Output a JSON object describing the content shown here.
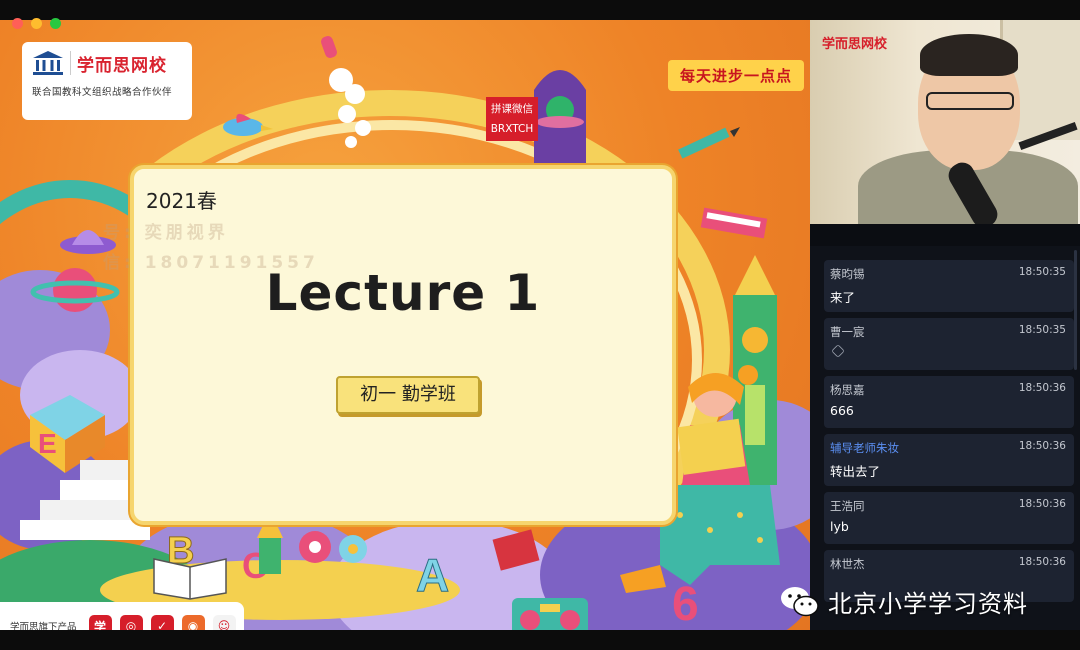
{
  "window": {
    "controls": [
      {
        "name": "close",
        "color": "#ff5f57"
      },
      {
        "name": "minimize",
        "color": "#febc2e"
      },
      {
        "name": "maximize",
        "color": "#28c840"
      }
    ]
  },
  "slide": {
    "logo": {
      "name": "学而思网校",
      "subtitle": "联合国教科文组织战略合作伙伴"
    },
    "motto": "每天进步一点点",
    "wechat_tag": {
      "line1": "拼课微信",
      "line2": "BRXTCH"
    },
    "watermark": {
      "line1": "号: 奕朋视界",
      "line2": "信: 18071191557"
    },
    "card": {
      "season": "2021春",
      "title": "Lecture 1",
      "class_name": "初一  勤学班"
    },
    "product_bar": {
      "label": "学而思旗下产品",
      "apps": [
        {
          "icon": "xue-app-icon",
          "glyph": "学"
        },
        {
          "icon": "search-app-icon",
          "glyph": "◎"
        },
        {
          "icon": "check-app-icon",
          "glyph": "✓"
        },
        {
          "icon": "kids-app-icon",
          "glyph": "◉"
        },
        {
          "icon": "mascot-app-icon",
          "glyph": "☺"
        }
      ]
    },
    "colors": {
      "brand_red": "#d61e2a",
      "card_bg": "#fdf8d8",
      "badge_bg": "#f9e27b"
    }
  },
  "video": {
    "brand": "学而思网校"
  },
  "chat": {
    "messages": [
      {
        "name": "蔡昀锡",
        "time": "18:50:35",
        "text": "来了",
        "is_tutor": false
      },
      {
        "name": "曹一宸",
        "time": "18:50:35",
        "text": "",
        "emoji": "cube-emoji-icon",
        "is_tutor": false
      },
      {
        "name": "杨思嘉",
        "time": "18:50:36",
        "text": "666",
        "is_tutor": false
      },
      {
        "name": "辅导老师朱妆",
        "time": "18:50:36",
        "text": "转出去了",
        "is_tutor": true
      },
      {
        "name": "王浩同",
        "time": "18:50:36",
        "text": "lyb",
        "is_tutor": false
      },
      {
        "name": "林世杰",
        "time": "18:50:36",
        "text": "",
        "is_tutor": false
      }
    ]
  },
  "overlay": {
    "account": "北京小学学习资料"
  }
}
